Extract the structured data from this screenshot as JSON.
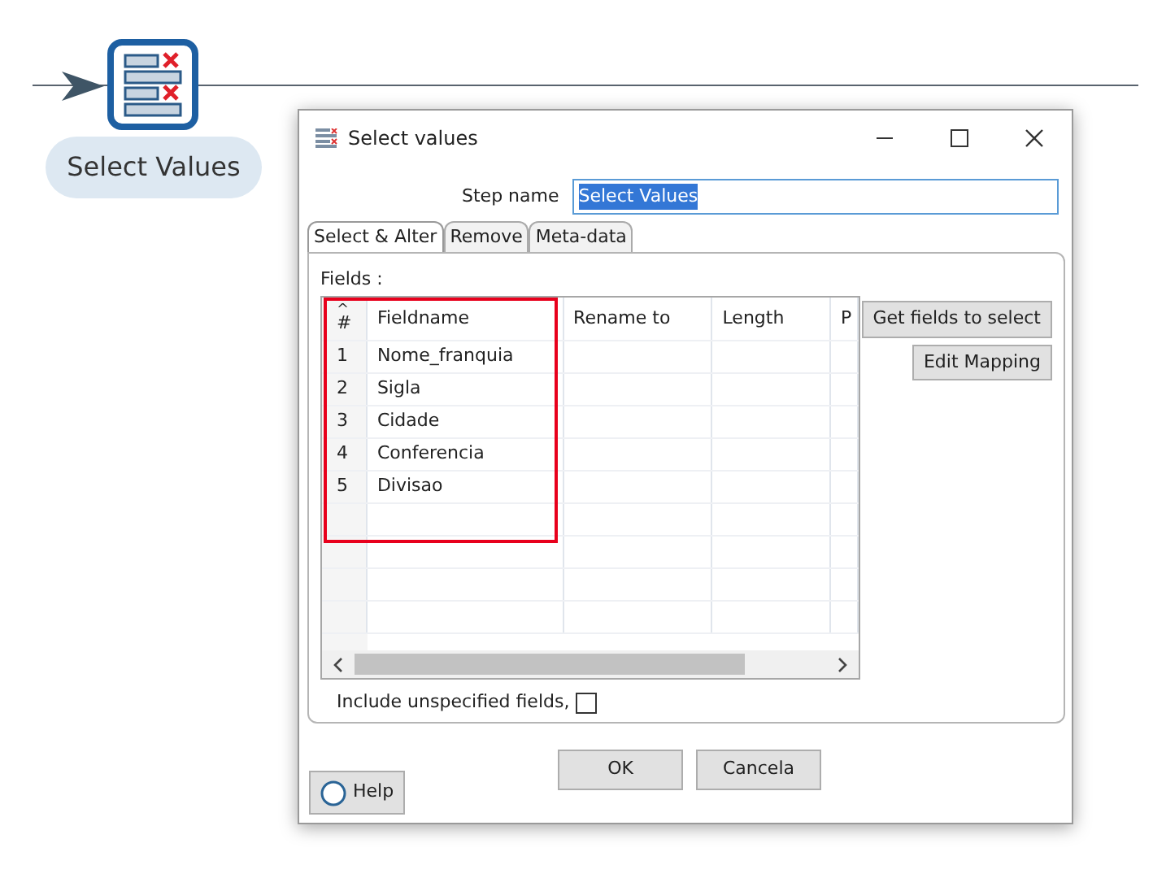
{
  "canvas": {
    "step": {
      "label": "Select Values"
    }
  },
  "dialog": {
    "title": "Select values",
    "step_name": {
      "label": "Step name",
      "value": "Select Values",
      "selected_text": true
    },
    "tabs": [
      {
        "label": "Select & Alter",
        "selected": true
      },
      {
        "label": "Remove",
        "selected": false
      },
      {
        "label": "Meta-data",
        "selected": false
      }
    ],
    "fields_label": "Fields :",
    "table": {
      "sort_mark": "^",
      "highlight_first_columns": true,
      "columns": [
        "#",
        "Fieldname",
        "Rename to",
        "Length",
        "P"
      ],
      "rows": [
        [
          "1",
          "Nome_franquia"
        ],
        [
          "2",
          "Sigla"
        ],
        [
          "3",
          "Cidade"
        ],
        [
          "4",
          "Conferencia"
        ],
        [
          "5",
          "Divisao"
        ]
      ]
    },
    "side_buttons": [
      "Get fields to select",
      "Edit Mapping"
    ],
    "include_unspecified": {
      "label": "Include unspecified fields,",
      "checked": false
    },
    "buttons": [
      "OK",
      "Cancela"
    ],
    "help": "Help"
  }
}
